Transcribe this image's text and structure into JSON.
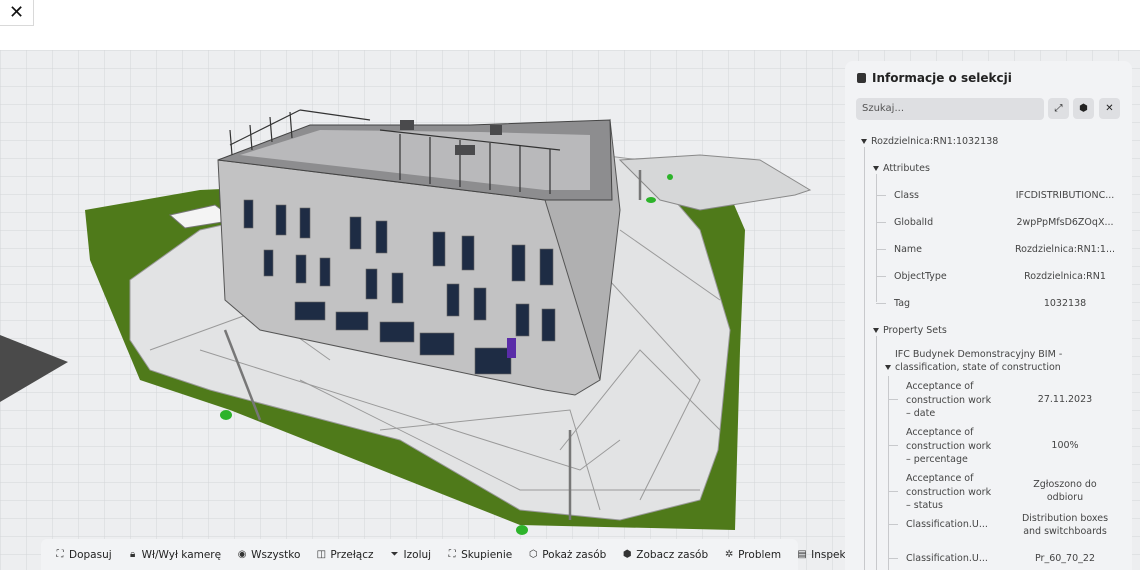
{
  "app": {
    "close_glyph": "✕"
  },
  "toolbar": {
    "items": [
      {
        "label": "Dopasuj",
        "icon": "fit-icon"
      },
      {
        "label": "Wł/Wył kamerę",
        "icon": "lock-icon"
      },
      {
        "label": "Wszystko",
        "icon": "eye-icon"
      },
      {
        "label": "Przełącz",
        "icon": "toggle-icon"
      },
      {
        "label": "Izoluj",
        "icon": "filter-icon"
      },
      {
        "label": "Skupienie",
        "icon": "focus-icon"
      },
      {
        "label": "Pokaż zasób",
        "icon": "cube-icon"
      },
      {
        "label": "Zobacz zasób",
        "icon": "cube-icon"
      },
      {
        "label": "Problem",
        "icon": "bug-icon"
      },
      {
        "label": "Inspekcja",
        "icon": "clipboard-icon"
      }
    ]
  },
  "panel": {
    "title": "Informacje o selekcji",
    "search_placeholder": "Szukaj...",
    "buttons": {
      "expand": "⤢",
      "export": "⬢",
      "close": "✕"
    },
    "root": "Rozdzielnica:RN1:1032138",
    "attributes_label": "Attributes",
    "attributes": [
      {
        "key": "Class",
        "value": "IFCDISTRIBUTIONC..."
      },
      {
        "key": "GlobalId",
        "value": "2wpPpMfsD6ZOqX..."
      },
      {
        "key": "Name",
        "value": "Rozdzielnica:RN1:1..."
      },
      {
        "key": "ObjectType",
        "value": "Rozdzielnica:RN1"
      },
      {
        "key": "Tag",
        "value": "1032138"
      }
    ],
    "property_sets_label": "Property Sets",
    "pset_name_line1": "IFC Budynek Demonstracyjny BIM -",
    "pset_name_line2": "classification, state of construction",
    "properties": [
      {
        "key": [
          "Acceptance of",
          "construction work",
          "– date"
        ],
        "value": [
          "27.11.2023"
        ]
      },
      {
        "key": [
          "Acceptance of",
          "construction work",
          "– percentage"
        ],
        "value": [
          "100%"
        ]
      },
      {
        "key": [
          "Acceptance of",
          "construction work",
          "– status"
        ],
        "value": [
          "Zgłoszono do",
          "odbioru"
        ]
      },
      {
        "key": [
          "Classification.U..."
        ],
        "value": [
          "Distribution boxes",
          "and switchboards"
        ]
      },
      {
        "key": [
          "Classification.U..."
        ],
        "value": [
          "Pr_60_70_22"
        ]
      }
    ]
  },
  "colors": {
    "grass": "#4f7a1a",
    "wall": "#c4c4c4",
    "ground": "#e4e4e4",
    "marker": "#2db32a",
    "highlight": "#5a2ca8"
  }
}
